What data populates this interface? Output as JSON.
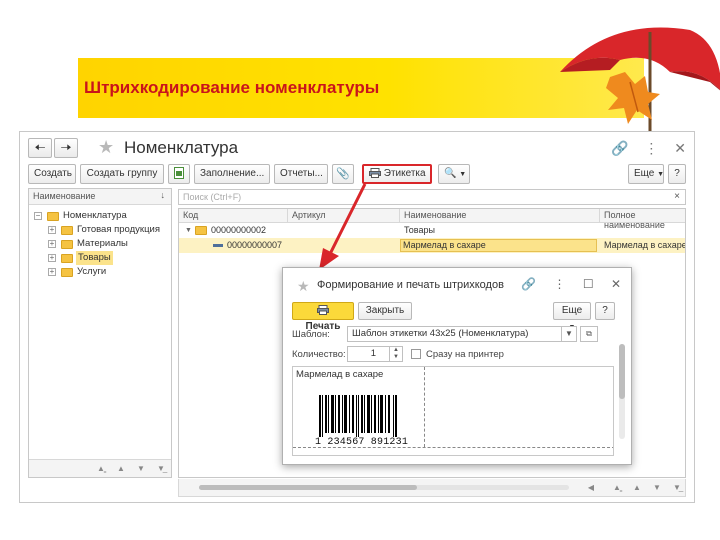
{
  "slide": {
    "title": "Штрихкодирование номенклатуры",
    "accent_color": "#c9141b",
    "banner_color": "#ffd400"
  },
  "window": {
    "title": "Номенклатура",
    "back_icon": "arrow-left-icon",
    "forward_icon": "arrow-right-icon",
    "toolbar": {
      "create": "Создать",
      "create_group": "Создать группу",
      "fill": "Заполнение...",
      "reports": "Отчеты...",
      "label": "Этикетка",
      "more": "Еще",
      "help": "?"
    },
    "tree": {
      "header": "Наименование",
      "items": [
        {
          "label": "Номенклатура"
        },
        {
          "label": "Готовая продукция"
        },
        {
          "label": "Материалы"
        },
        {
          "label": "Товары"
        },
        {
          "label": "Услуги"
        }
      ]
    },
    "search": {
      "placeholder": "Поиск (Ctrl+F)",
      "clear": "×"
    },
    "grid": {
      "columns": [
        "Код",
        "Артикул",
        "Наименование",
        "Полное наименование"
      ],
      "rows": [
        {
          "code": "00000000002",
          "article": "",
          "name": "Товары",
          "full_name": ""
        },
        {
          "code": "00000000007",
          "article": "",
          "name": "Мармелад в сахаре",
          "full_name": "Мармелад в сахаре"
        }
      ]
    }
  },
  "dialog": {
    "title": "Формирование и печать штрихкодов",
    "print": "Печать",
    "close": "Закрыть",
    "more": "Еще",
    "help": "?",
    "template_label": "Шаблон:",
    "template_value": "Шаблон этикетки 43x25 (Номенклатура)",
    "quantity_label": "Количество:",
    "quantity_value": "1",
    "direct_print": "Сразу на принтер",
    "preview_item": "Мармелад в сахаре",
    "barcode_number": "1 234567 891231"
  }
}
